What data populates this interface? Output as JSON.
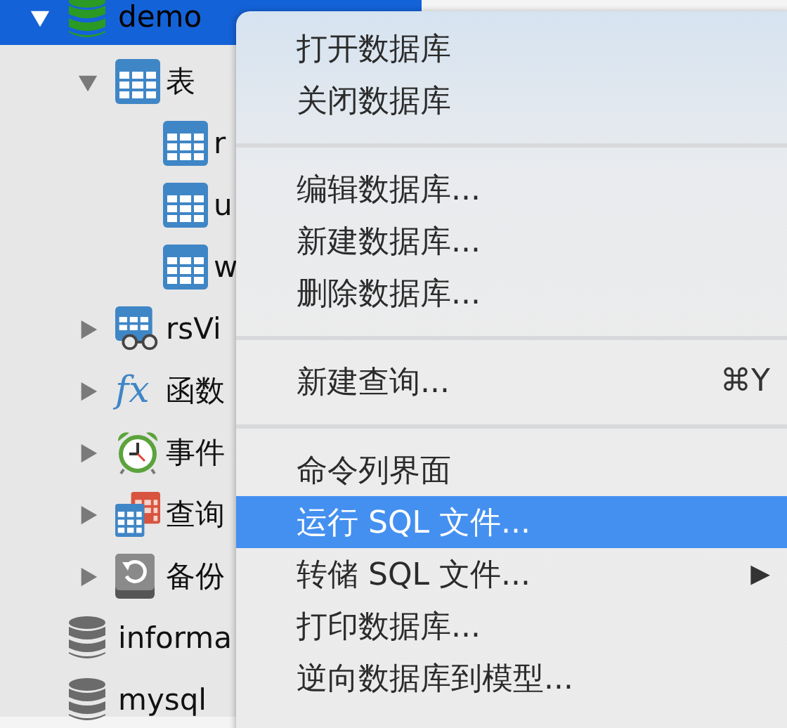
{
  "tree": [
    {
      "kind": "database",
      "label": "demo",
      "color": "#2a9a24",
      "expanded": true,
      "selected": true,
      "children": [
        {
          "kind": "tables",
          "label": "表",
          "expanded": true,
          "selected": false,
          "children": [
            {
              "kind": "table",
              "label": "r",
              "selected": false
            },
            {
              "kind": "table",
              "label": "u",
              "selected": false
            },
            {
              "kind": "table",
              "label": "w",
              "selected": false
            }
          ]
        },
        {
          "kind": "views",
          "label": "rsVi",
          "expanded": false,
          "selected": false
        },
        {
          "kind": "functions",
          "label": "函数",
          "icon_glyph": "fx",
          "expanded": false,
          "selected": false
        },
        {
          "kind": "events",
          "label": "事件",
          "expanded": false,
          "selected": false
        },
        {
          "kind": "queries",
          "label": "查询",
          "expanded": false,
          "selected": false
        },
        {
          "kind": "backups",
          "label": "备份",
          "expanded": false,
          "selected": false
        }
      ]
    },
    {
      "kind": "database",
      "label": "informa",
      "color": "#6b6b6b",
      "selected": false
    },
    {
      "kind": "database",
      "label": "mysql",
      "color": "#6b6b6b",
      "selected": false
    }
  ],
  "context_menu": [
    {
      "kind": "item",
      "label": "打开数据库",
      "selected": false
    },
    {
      "kind": "item",
      "label": "关闭数据库",
      "selected": false
    },
    {
      "kind": "separator"
    },
    {
      "kind": "item",
      "label": "编辑数据库...",
      "selected": false
    },
    {
      "kind": "item",
      "label": "新建数据库...",
      "selected": false
    },
    {
      "kind": "item",
      "label": "删除数据库...",
      "selected": false
    },
    {
      "kind": "separator"
    },
    {
      "kind": "item",
      "label": "新建查询...",
      "shortcut": "⌘Y",
      "selected": false
    },
    {
      "kind": "separator"
    },
    {
      "kind": "item",
      "label": "命令列界面",
      "selected": false
    },
    {
      "kind": "item",
      "label": "运行 SQL 文件...",
      "selected": true
    },
    {
      "kind": "item",
      "label": "转储 SQL 文件...",
      "submenu": "▶",
      "selected": false
    },
    {
      "kind": "item",
      "label": "打印数据库...",
      "selected": false
    },
    {
      "kind": "item",
      "label": "逆向数据库到模型...",
      "selected": false
    }
  ]
}
